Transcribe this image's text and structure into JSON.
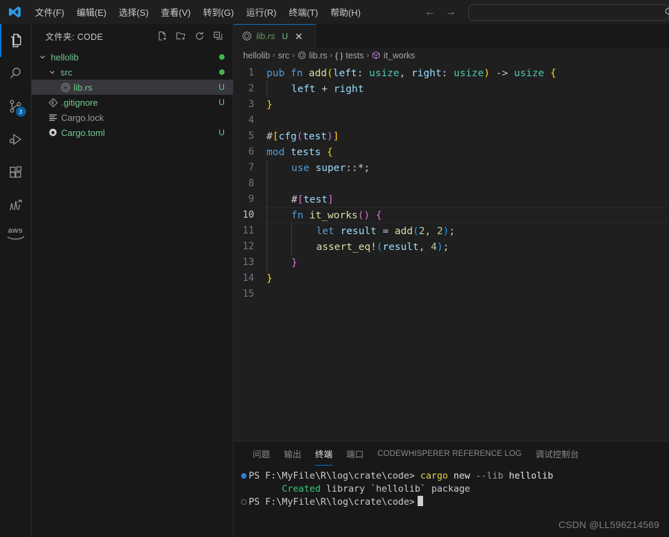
{
  "titlebar": {
    "logo_icon": "vscode-logo-icon",
    "menus": [
      {
        "label": "文件(F)",
        "name": "menu-file"
      },
      {
        "label": "编辑(E)",
        "name": "menu-edit"
      },
      {
        "label": "选择(S)",
        "name": "menu-selection"
      },
      {
        "label": "查看(V)",
        "name": "menu-view"
      },
      {
        "label": "转到(G)",
        "name": "menu-goto"
      },
      {
        "label": "运行(R)",
        "name": "menu-run"
      },
      {
        "label": "终端(T)",
        "name": "menu-terminal"
      },
      {
        "label": "帮助(H)",
        "name": "menu-help"
      }
    ],
    "nav_back": "←",
    "nav_forward": "→",
    "command_center_value": "",
    "command_center_placeholder": ""
  },
  "activitybar": {
    "items": [
      {
        "name": "activity-explorer",
        "icon": "files-icon",
        "active": true,
        "badge": ""
      },
      {
        "name": "activity-search",
        "icon": "search-icon",
        "active": false,
        "badge": ""
      },
      {
        "name": "activity-source-control",
        "icon": "source-control-icon",
        "active": false,
        "badge": "3"
      },
      {
        "name": "activity-run-debug",
        "icon": "run-and-debug-icon",
        "active": false,
        "badge": ""
      },
      {
        "name": "activity-extensions",
        "icon": "extensions-icon",
        "active": false,
        "badge": ""
      },
      {
        "name": "activity-testing",
        "icon": "chart-arrow-icon",
        "active": false,
        "badge": ""
      }
    ],
    "aws_label": "aws"
  },
  "sidebar": {
    "title": "文件夹: CODE",
    "actions": [
      {
        "name": "new-file-icon",
        "label": "新建文件"
      },
      {
        "name": "new-folder-icon",
        "label": "新建文件夹"
      },
      {
        "name": "refresh-icon",
        "label": "刷新"
      },
      {
        "name": "collapse-all-icon",
        "label": "全部折叠"
      }
    ],
    "tree": [
      {
        "label": "hellolib",
        "indent": 0,
        "type": "folder",
        "expanded": true,
        "git": "",
        "dot": true,
        "color": "green",
        "icon": "chevron-down-icon",
        "selected": false
      },
      {
        "label": "src",
        "indent": 1,
        "type": "folder",
        "expanded": true,
        "git": "",
        "dot": true,
        "color": "green",
        "icon": "chevron-down-icon",
        "selected": false
      },
      {
        "label": "lib.rs",
        "indent": 2,
        "type": "file",
        "expanded": false,
        "git": "U",
        "dot": false,
        "color": "green",
        "icon": "rust-file-icon",
        "selected": true
      },
      {
        "label": ".gitignore",
        "indent": 1,
        "type": "file",
        "expanded": false,
        "git": "U",
        "dot": false,
        "color": "green",
        "icon": "git-file-icon",
        "selected": false
      },
      {
        "label": "Cargo.lock",
        "indent": 1,
        "type": "file",
        "expanded": false,
        "git": "",
        "dot": false,
        "color": "gray",
        "icon": "lock-lines-icon",
        "selected": false
      },
      {
        "label": "Cargo.toml",
        "indent": 1,
        "type": "file",
        "expanded": false,
        "git": "U",
        "dot": false,
        "color": "green",
        "icon": "gear-icon",
        "selected": false
      }
    ]
  },
  "editor": {
    "tab": {
      "label": "lib.rs",
      "git": "U",
      "close": "✕",
      "icon": "rust-file-icon"
    },
    "breadcrumb": [
      {
        "label": "hellolib",
        "icon": ""
      },
      {
        "label": "src",
        "icon": ""
      },
      {
        "label": "lib.rs",
        "icon": "rust-file-icon"
      },
      {
        "label": "tests",
        "icon": "namespace-braces-icon"
      },
      {
        "label": "it_works",
        "icon": "method-cube-icon"
      }
    ],
    "breadcrumb_separator": "›",
    "current_line": 10,
    "lines": [
      {
        "n": 1,
        "text": "pub fn add(left: usize, right: usize) -> usize {"
      },
      {
        "n": 2,
        "text": "    left + right"
      },
      {
        "n": 3,
        "text": "}"
      },
      {
        "n": 4,
        "text": ""
      },
      {
        "n": 5,
        "text": "#[cfg(test)]"
      },
      {
        "n": 6,
        "text": "mod tests {"
      },
      {
        "n": 7,
        "text": "    use super::*;"
      },
      {
        "n": 8,
        "text": ""
      },
      {
        "n": 9,
        "text": "    #[test]"
      },
      {
        "n": 10,
        "text": "    fn it_works() {"
      },
      {
        "n": 11,
        "text": "        let result = add(2, 2);"
      },
      {
        "n": 12,
        "text": "        assert_eq!(result, 4);"
      },
      {
        "n": 13,
        "text": "    }"
      },
      {
        "n": 14,
        "text": "}"
      },
      {
        "n": 15,
        "text": ""
      }
    ]
  },
  "panel": {
    "tabs": [
      {
        "label": "问题",
        "name": "panel-tab-problems",
        "active": false,
        "cn": true
      },
      {
        "label": "输出",
        "name": "panel-tab-output",
        "active": false,
        "cn": true
      },
      {
        "label": "终端",
        "name": "panel-tab-terminal",
        "active": true,
        "cn": true
      },
      {
        "label": "端口",
        "name": "panel-tab-ports",
        "active": false,
        "cn": true
      },
      {
        "label": "CODEWHISPERER REFERENCE LOG",
        "name": "panel-tab-codewhisperer",
        "active": false,
        "cn": false
      },
      {
        "label": "调试控制台",
        "name": "panel-tab-debug-console",
        "active": false,
        "cn": true
      }
    ],
    "terminal": {
      "prompt": "PS F:\\MyFile\\R\\log\\crate\\code>",
      "line1_cmd": "cargo",
      "line1_arg1": "new",
      "line1_flag": "--lib",
      "line1_arg2": "hellolib",
      "line2_created": "Created",
      "line2_rest": " library `hellolib` package",
      "line2_indent": "      "
    }
  },
  "watermark": "CSDN @LL596214569",
  "colors": {
    "accent": "#0078d4",
    "badge": "#0078d4",
    "git_green": "#73c991",
    "folder_dot": "#3fb950",
    "editor_bg": "#1f1f1f",
    "sidebar_bg": "#181818"
  }
}
